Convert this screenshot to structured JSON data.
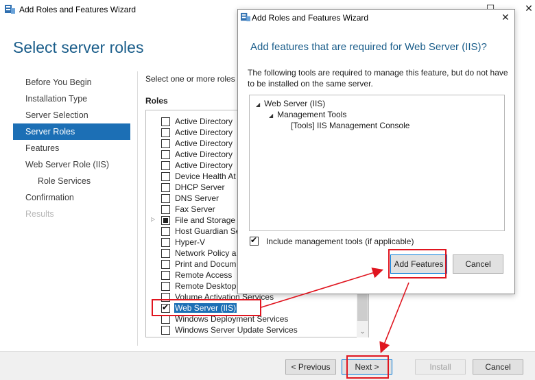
{
  "window": {
    "title": "Add Roles and Features Wizard",
    "minimize_glyph": "—",
    "maximize_glyph": "☐"
  },
  "page_title": "Select server roles",
  "nav": [
    {
      "label": "Before You Begin",
      "state": "normal"
    },
    {
      "label": "Installation Type",
      "state": "normal"
    },
    {
      "label": "Server Selection",
      "state": "normal"
    },
    {
      "label": "Server Roles",
      "state": "active"
    },
    {
      "label": "Features",
      "state": "normal"
    },
    {
      "label": "Web Server Role (IIS)",
      "state": "normal"
    },
    {
      "label": "Role Services",
      "state": "sub"
    },
    {
      "label": "Confirmation",
      "state": "normal"
    },
    {
      "label": "Results",
      "state": "disabled"
    }
  ],
  "description": "Select one or more roles",
  "roles_label": "Roles",
  "roles": [
    {
      "label": "Active Directory",
      "check": "none",
      "expander": false
    },
    {
      "label": "Active Directory",
      "check": "none",
      "expander": false
    },
    {
      "label": "Active Directory",
      "check": "none",
      "expander": false
    },
    {
      "label": "Active Directory",
      "check": "none",
      "expander": false
    },
    {
      "label": "Active Directory",
      "check": "none",
      "expander": false
    },
    {
      "label": "Device Health At",
      "check": "none",
      "expander": false
    },
    {
      "label": "DHCP Server",
      "check": "none",
      "expander": false
    },
    {
      "label": "DNS Server",
      "check": "none",
      "expander": false
    },
    {
      "label": "Fax Server",
      "check": "none",
      "expander": false
    },
    {
      "label": "File and Storage",
      "check": "partial",
      "expander": true
    },
    {
      "label": "Host Guardian Se",
      "check": "none",
      "expander": false
    },
    {
      "label": "Hyper-V",
      "check": "none",
      "expander": false
    },
    {
      "label": "Network Policy a",
      "check": "none",
      "expander": false
    },
    {
      "label": "Print and Docum",
      "check": "none",
      "expander": false
    },
    {
      "label": "Remote Access",
      "check": "none",
      "expander": false
    },
    {
      "label": "Remote Desktop",
      "check": "none",
      "expander": false
    },
    {
      "label": "Volume Activation Services",
      "check": "none",
      "expander": false
    },
    {
      "label": "Web Server (IIS)",
      "check": "checked",
      "expander": false,
      "selected": true
    },
    {
      "label": "Windows Deployment Services",
      "check": "none",
      "expander": false
    },
    {
      "label": "Windows Server Update Services",
      "check": "none",
      "expander": false
    }
  ],
  "footer": {
    "previous": "< Previous",
    "next": "Next >",
    "install": "Install",
    "cancel": "Cancel"
  },
  "modal": {
    "title": "Add Roles and Features Wizard",
    "heading": "Add features that are required for Web Server (IIS)?",
    "text": "The following tools are required to manage this feature, but do not have to be installed on the same server.",
    "tree": [
      {
        "label": "Web Server (IIS)",
        "level": 0,
        "expander": true
      },
      {
        "label": "Management Tools",
        "level": 1,
        "expander": true
      },
      {
        "label": "[Tools] IIS Management Console",
        "level": 2,
        "expander": false
      }
    ],
    "include_label": "Include management tools (if applicable)",
    "include_checked": true,
    "add_features": "Add Features",
    "cancel": "Cancel"
  },
  "colors": {
    "accent": "#1c6fb5",
    "heading": "#1a5d8a",
    "annotation": "#e0151f"
  }
}
